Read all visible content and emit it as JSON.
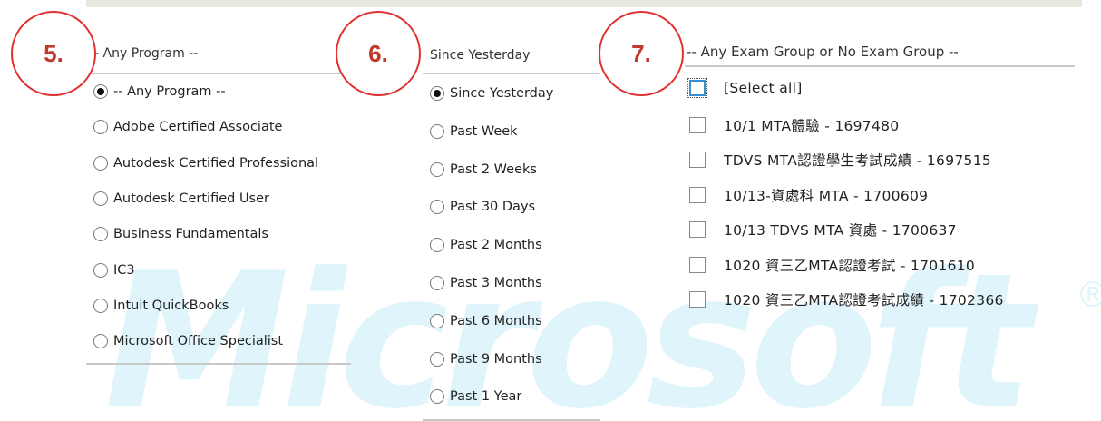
{
  "steps": {
    "s5": "5.",
    "s6": "6.",
    "s7": "7."
  },
  "watermark": {
    "text": "Microsoft",
    "reg": "®"
  },
  "program": {
    "header": "- Any Program --",
    "options": [
      "-- Any Program --",
      "Adobe Certified Associate",
      "Autodesk Certified Professional",
      "Autodesk Certified User",
      "Business Fundamentals",
      "IC3",
      "Intuit QuickBooks",
      "Microsoft Office Specialist"
    ],
    "selected_index": 0
  },
  "period": {
    "header": "Since Yesterday",
    "options": [
      "Since Yesterday",
      "Past Week",
      "Past 2 Weeks",
      "Past 30 Days",
      "Past 2 Months",
      "Past 3 Months",
      "Past 6 Months",
      "Past 9 Months",
      "Past 1 Year"
    ],
    "selected_index": 0
  },
  "exam_group": {
    "header": "-- Any Exam Group or No Exam Group --",
    "options": [
      "[Select all]",
      "10/1 MTA體驗 - 1697480",
      "TDVS MTA認證學生考試成績 - 1697515",
      "10/13-資處科 MTA - 1700609",
      "10/13 TDVS MTA 資處 - 1700637",
      "1020 資三乙MTA認證考試 - 1701610",
      "1020 資三乙MTA認證考試成績 - 1702366"
    ]
  },
  "colors": {
    "accent_red": "#e03030",
    "watermark": "#dff4fb",
    "focus_blue": "#3a8fd1"
  }
}
